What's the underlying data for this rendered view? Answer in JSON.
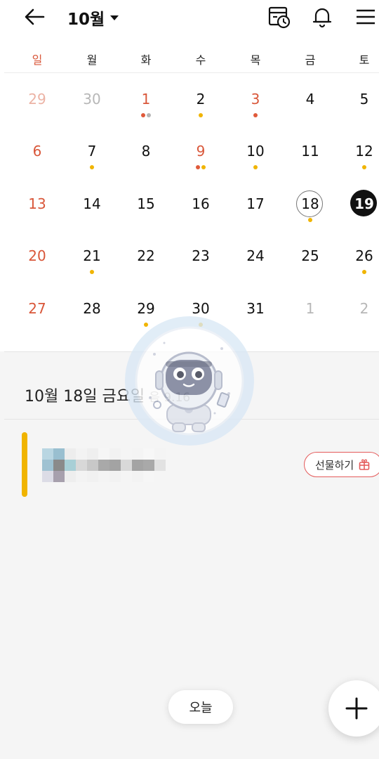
{
  "header": {
    "month_label": "10월",
    "icons": [
      "back-arrow-icon",
      "calendar-clock-icon",
      "bell-icon",
      "menu-icon"
    ]
  },
  "weekdays": [
    "일",
    "월",
    "화",
    "수",
    "목",
    "금",
    "토"
  ],
  "calendar": {
    "weeks": [
      [
        {
          "day": "29",
          "tone": "pale",
          "dots": []
        },
        {
          "day": "30",
          "tone": "grey",
          "dots": []
        },
        {
          "day": "1",
          "tone": "red",
          "dots": [
            "#e05a3a",
            "#b5b5b5"
          ]
        },
        {
          "day": "2",
          "tone": "normal",
          "dots": [
            "#f0b400"
          ]
        },
        {
          "day": "3",
          "tone": "red",
          "dots": [
            "#e05a3a"
          ]
        },
        {
          "day": "4",
          "tone": "normal",
          "dots": []
        },
        {
          "day": "5",
          "tone": "normal",
          "dots": []
        }
      ],
      [
        {
          "day": "6",
          "tone": "red",
          "dots": []
        },
        {
          "day": "7",
          "tone": "normal",
          "dots": [
            "#f0b400"
          ]
        },
        {
          "day": "8",
          "tone": "normal",
          "dots": []
        },
        {
          "day": "9",
          "tone": "red",
          "dots": [
            "#e05a3a",
            "#f0b400"
          ]
        },
        {
          "day": "10",
          "tone": "normal",
          "dots": [
            "#f0b400"
          ]
        },
        {
          "day": "11",
          "tone": "normal",
          "dots": []
        },
        {
          "day": "12",
          "tone": "normal",
          "dots": [
            "#f0b400"
          ]
        }
      ],
      [
        {
          "day": "13",
          "tone": "red",
          "dots": []
        },
        {
          "day": "14",
          "tone": "normal",
          "dots": []
        },
        {
          "day": "15",
          "tone": "normal",
          "dots": []
        },
        {
          "day": "16",
          "tone": "normal",
          "dots": []
        },
        {
          "day": "17",
          "tone": "normal",
          "dots": []
        },
        {
          "day": "18",
          "tone": "normal",
          "dots": [
            "#f0b400"
          ],
          "mark": "selected"
        },
        {
          "day": "19",
          "tone": "normal",
          "dots": [],
          "mark": "today"
        }
      ],
      [
        {
          "day": "20",
          "tone": "red",
          "dots": []
        },
        {
          "day": "21",
          "tone": "normal",
          "dots": [
            "#f0b400"
          ]
        },
        {
          "day": "22",
          "tone": "normal",
          "dots": []
        },
        {
          "day": "23",
          "tone": "normal",
          "dots": []
        },
        {
          "day": "24",
          "tone": "normal",
          "dots": []
        },
        {
          "day": "25",
          "tone": "normal",
          "dots": []
        },
        {
          "day": "26",
          "tone": "normal",
          "dots": [
            "#f0b400"
          ]
        }
      ],
      [
        {
          "day": "27",
          "tone": "red",
          "dots": []
        },
        {
          "day": "28",
          "tone": "normal",
          "dots": []
        },
        {
          "day": "29",
          "tone": "normal",
          "dots": [
            "#f0b400"
          ]
        },
        {
          "day": "30",
          "tone": "normal",
          "dots": [
            "#f0b400"
          ]
        },
        {
          "day": "31",
          "tone": "normal",
          "dots": []
        },
        {
          "day": "1",
          "tone": "grey",
          "dots": []
        },
        {
          "day": "2",
          "tone": "grey",
          "dots": []
        }
      ]
    ]
  },
  "selected_day": {
    "date_label": "10월 18일 금요일",
    "lunar_label": "음 9.16"
  },
  "event": {
    "bar_color": "#f0b400",
    "gift_label": "선물하기"
  },
  "footer": {
    "today_label": "오늘",
    "add_icon": "plus-icon"
  },
  "colors": {
    "sunday_red": "#d9573a",
    "accent_yellow": "#f0b400",
    "gift_border": "#e45b5b"
  }
}
